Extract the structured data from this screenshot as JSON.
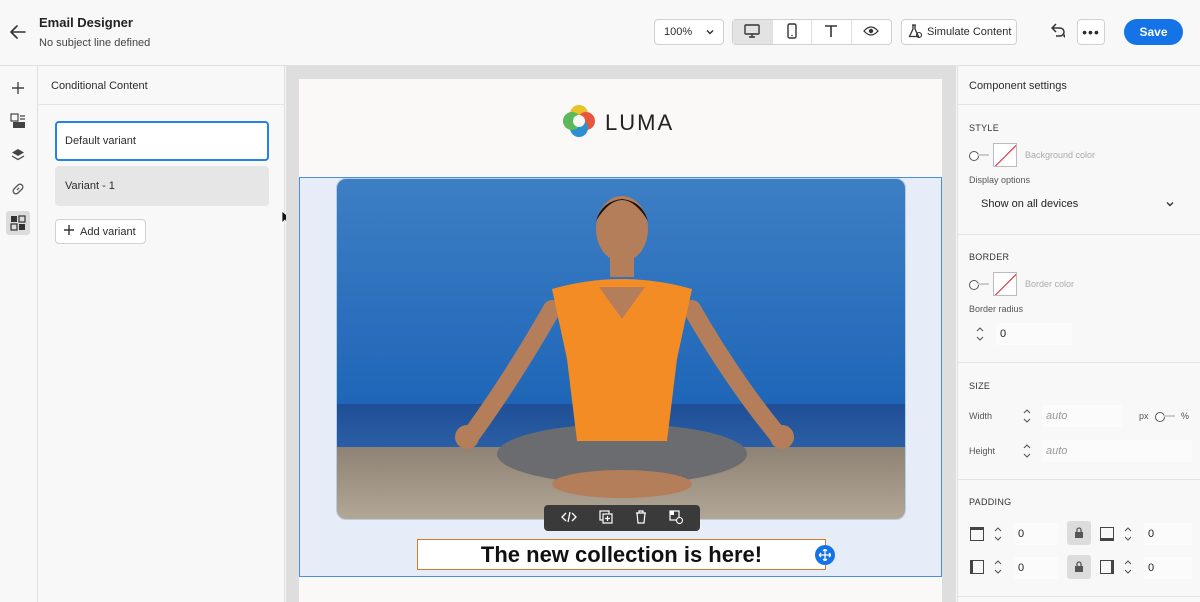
{
  "header": {
    "title": "Email Designer",
    "subtitle": "No subject line defined",
    "zoom": "100%",
    "simulate_label": "Simulate Content",
    "save_label": "Save"
  },
  "left_rail": {
    "items": [
      "plus-icon",
      "image-layout-icon",
      "layers-icon",
      "link-icon",
      "conditional-content-icon"
    ],
    "active": "conditional-content-icon"
  },
  "conditional_panel": {
    "title": "Conditional Content",
    "variants": [
      "Default variant",
      "Variant - 1"
    ],
    "selected_variant": "Default variant",
    "add_variant_label": "Add variant"
  },
  "email": {
    "logo_text": "LUMA",
    "headline": "The new collection is here!"
  },
  "settings": {
    "title": "Component settings",
    "style_header": "STYLE",
    "background_color_label": "Background color",
    "display_options_label": "Display options",
    "display_options_value": "Show on all devices",
    "border_header": "BORDER",
    "border_color_label": "Border color",
    "border_radius_label": "Border radius",
    "border_radius_value": "0",
    "size_header": "SIZE",
    "width_label": "Width",
    "width_placeholder": "auto",
    "height_label": "Height",
    "height_placeholder": "auto",
    "unit_px": "px",
    "unit_pct": "%",
    "padding_header": "PADDING",
    "padding_top": "0",
    "padding_bottom": "0",
    "padding_left": "0",
    "padding_right": "0"
  },
  "colors": {
    "accent": "#1473e6",
    "selection": "#2680eb",
    "headline_border": "#d37b2a"
  }
}
